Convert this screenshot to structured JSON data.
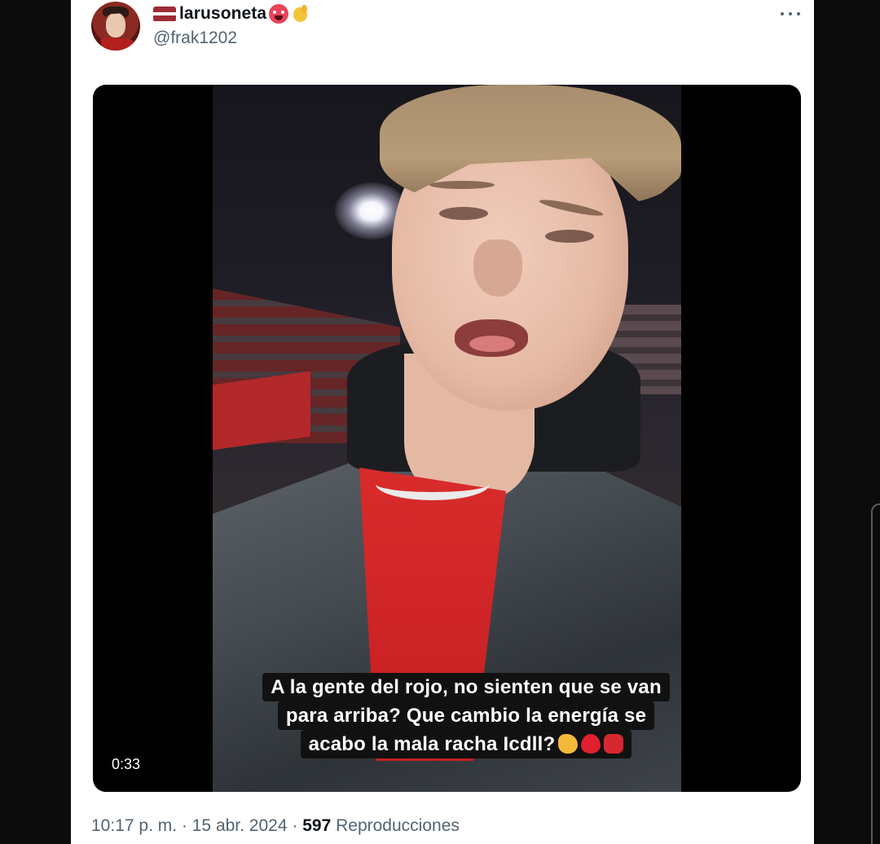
{
  "tweet": {
    "display_name": "larusoneta",
    "handle": "@frak1202",
    "more_icon": "more-horizontal-icon",
    "avatar_icon": "avatar"
  },
  "video": {
    "duration": "0:33",
    "caption": {
      "line1": "A la gente del rojo, no sienten que se van",
      "line2": "para arriba? Que cambio la energía se",
      "line3": "acabo la mala racha Icdll?"
    }
  },
  "footer": {
    "time": "10:17 p. m.",
    "separator": "·",
    "date": "15 abr. 2024",
    "views_count": "597",
    "views_label": "Reproducciones"
  }
}
